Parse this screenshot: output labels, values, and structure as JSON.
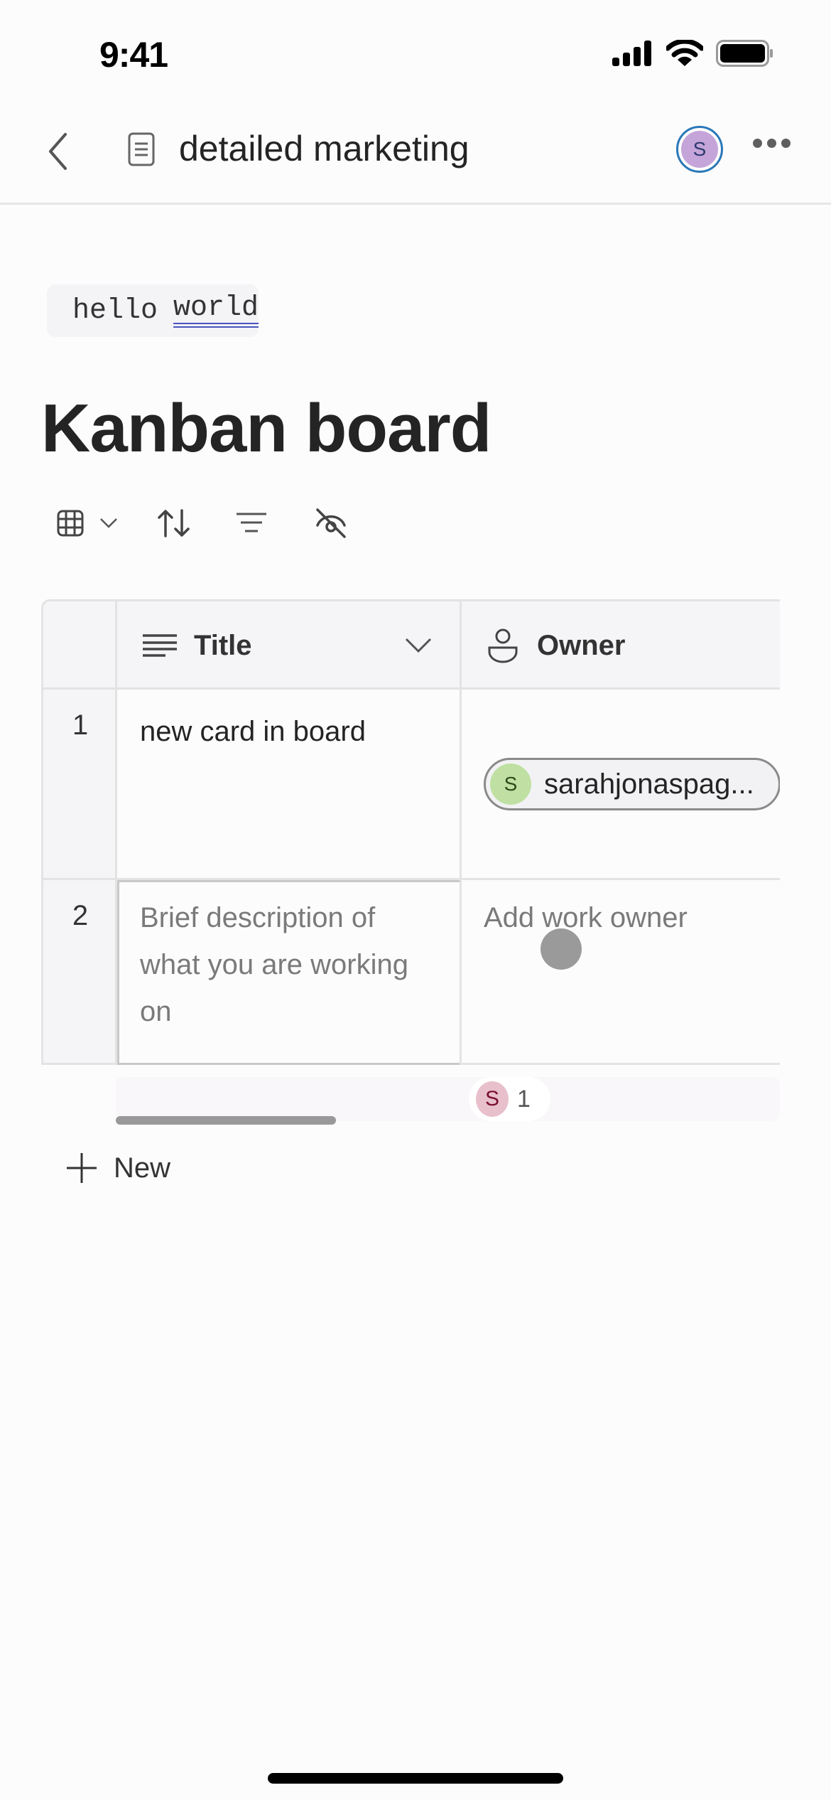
{
  "status_bar": {
    "time": "9:41"
  },
  "nav": {
    "doc_title": "detailed marketing",
    "avatar_initial": "S",
    "avatar_color": "#c5a5d9",
    "avatar_ring_color": "#2a78b8"
  },
  "code_snippet": {
    "word1": "hello",
    "word2": "world"
  },
  "heading": "Kanban board",
  "toolbar": {
    "icons": [
      "grid-view-icon",
      "sort-icon",
      "filter-icon",
      "hide-fields-icon"
    ]
  },
  "table": {
    "columns": [
      {
        "label": "Title",
        "icon": "text-lines-icon"
      },
      {
        "label": "Owner",
        "icon": "person-icon"
      }
    ],
    "rows": [
      {
        "num": "1",
        "title": "new card in board",
        "owner": {
          "initial": "S",
          "name": "sarahjonaspag...",
          "color": "#bfe0a2"
        }
      },
      {
        "num": "2",
        "title_placeholder": "Brief description of what you are working on",
        "owner_placeholder": "Add work owner"
      }
    ]
  },
  "presence": {
    "initial": "S",
    "count": "1",
    "color": "#e8c0cc"
  },
  "new_button": {
    "label": "New"
  }
}
